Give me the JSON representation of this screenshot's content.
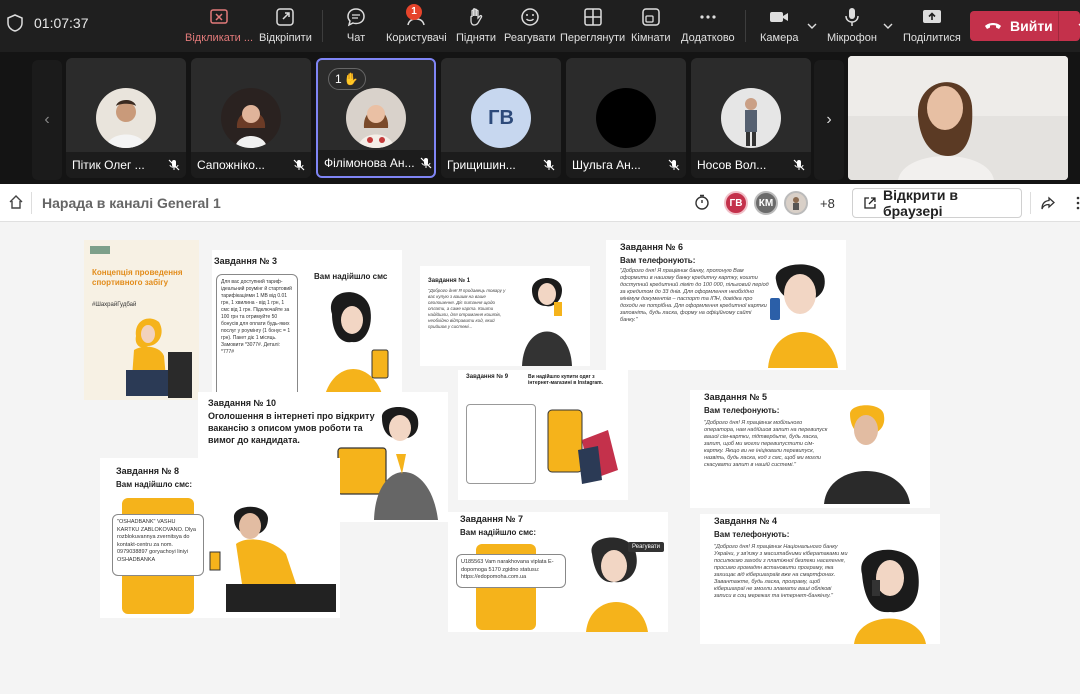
{
  "toolbar": {
    "timer": "01:07:37",
    "buttons": {
      "unpin": "Відкликати ...",
      "detach": "Відкріпити",
      "chat": "Чат",
      "users": "Користувачі",
      "users_badge": "1",
      "raise": "Підняти",
      "react": "Реагувати",
      "view": "Переглянути",
      "rooms": "Кімнати",
      "more": "Додатково",
      "camera": "Камера",
      "mic": "Мікрофон",
      "share": "Поділитися",
      "leave": "Вийти"
    }
  },
  "participants": [
    {
      "name": "Пітик Олег ...",
      "type": "photo"
    },
    {
      "name": "Сапожніко...",
      "type": "photo"
    },
    {
      "name": "Філімонова Ан...",
      "type": "photo",
      "hand": "1"
    },
    {
      "name": "Грищишин...",
      "type": "initials",
      "initials": "ГВ"
    },
    {
      "name": "Шульга Ан...",
      "type": "black"
    },
    {
      "name": "Носов Вол...",
      "type": "photo"
    }
  ],
  "meeting": {
    "title": "Нарада в каналі General 1",
    "avatars": [
      "ГВ",
      "КМ"
    ],
    "more_count": "+8",
    "open_browser": "Відкрити в браузері"
  },
  "slides": {
    "cover": {
      "title": "Концепція проведення спортивного забігу",
      "tag": "#ШахрайГудбай"
    },
    "t3": {
      "title": "Завдання № 3",
      "sub": "Вам надійшло смс",
      "text": "Для вас доступний тариф-ідеальний роумінг й стартовий тарифікаціями 1 МВ від 0.01 грн, 1 хвилина - від 1 грн, 1 смс від 1 грн. Підключайте за 100 грн та отримуйте 50 бонусів для оплати будь-яких послуг у роумінгу (1 бонус = 1 грн). Пакет діє 1 місяць. Замовити *3077#. Деталі: *777#"
    },
    "t1": {
      "title": "Завдання № 1",
      "text": "\"Доброго дня! Я продавець товару у вас купую з вашим на ваше оголошення. Діє питання щодо оплати, а саме карта. Кошти надійшли, для отримання коштів, необхідно відправити код, який прийшов у системі..."
    },
    "t6": {
      "title": "Завдання № 6",
      "sub": "Вам телефонують:",
      "text": "\"Доброго дня! Я працівник банку, пропоную Вам оформити в нашому банку кредитну картку, кошти доступний кредитний ліміт до 100 000, пільговий період за кредитом до 33 днів. Для оформлення необхідно мінімум документів – паспорт та ІПН, довідка про доходи не потрібна. Для оформлення кредитної картки заповніть, будь ласка, форму на офіційному сайті банку.\""
    },
    "t10": {
      "title": "Завдання № 10",
      "text": "Оголошення в інтернеті про відкриту вакансію з описом умов роботи та вимог до кандидата."
    },
    "t9": {
      "title": "Завдання № 9",
      "sub": "Ви надійшло купити одяг з інтернет-магазині в Instagram."
    },
    "t5": {
      "title": "Завдання № 5",
      "sub": "Вам телефонують:",
      "text": "\"Доброго дня! Я працівник мобільного оператора, нам надійшов запит на перевипуск вашої сім-картки, підтвердьте, будь ласка, запит, щоб ми могли перевипустити сім-картку. Якщо ви не ініціювали перевипуск, назвіть, будь ласка, код з смс, щоб ми могли скасувати запит в нашій системі.\""
    },
    "t8": {
      "title": "Завдання № 8",
      "sub": "Вам надійшло смс:",
      "sms": "\"OSHADBANK\" VASHU KARTKU ZABLOKOVANO. Dlya rozblokuvannya zvernitsya do kontakt-centru za nom. 0979038897 goryachoyi liniyi OSHADBANKA"
    },
    "t7": {
      "title": "Завдання № 7",
      "sub": "Вам надійшло смс:",
      "sms": "U185563 Vam narakhovana viplata E-dopomoga 5170 zgidno statusu: https://edopomoha.com.ua",
      "reply": "Реагувати"
    },
    "t4": {
      "title": "Завдання № 4",
      "sub": "Вам телефонують:",
      "text": "\"Доброго дня! Я працівник Національного банку України, у зв'язку з масштабними кібератаками ми посилюємо заходи з платіжної безпеки населення, просимо громадян встановити програму, яка захищає від кібершахраїв вже на смартфонах. Завантажте, будь ласка, програму, щоб кібершахраї не змогли зламати ваші облікові записи в соц мережах та інтернет-банкінгу.\""
    }
  },
  "colors": {
    "accent": "#f5b31b",
    "leave": "#c4314b",
    "active_border": "#7f85f5"
  }
}
